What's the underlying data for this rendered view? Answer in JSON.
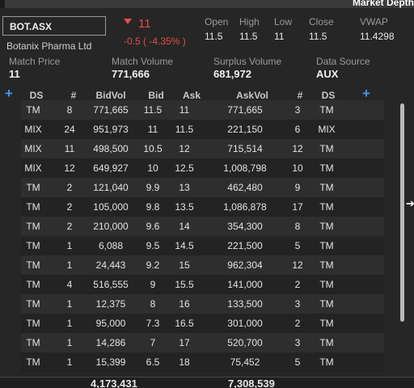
{
  "window": {
    "title": "Market Depth"
  },
  "security": {
    "code": "BOT.ASX",
    "name": "Botanix Pharma Ltd",
    "last": "11",
    "change_detail": "-0.5 ( -4.35% )",
    "direction": "down"
  },
  "stats": {
    "open_label": "Open",
    "open": "11.5",
    "high_label": "High",
    "high": "11.5",
    "low_label": "Low",
    "low": "11",
    "close_label": "Close",
    "close": "11.5",
    "vwap_label": "VWAP",
    "vwap": "11.4298"
  },
  "info": {
    "match_price_label": "Match Price",
    "match_price": "11",
    "match_volume_label": "Match Volume",
    "match_volume": "771,666",
    "surplus_volume_label": "Surplus Volume",
    "surplus_volume": "681,972",
    "data_source_label": "Data Source",
    "data_source": "AUX"
  },
  "table": {
    "headers": {
      "bid_ds": "DS",
      "bid_count": "#",
      "bid_vol": "BidVol",
      "bid": "Bid",
      "ask": "Ask",
      "ask_vol": "AskVol",
      "ask_count": "#",
      "ask_ds": "DS"
    },
    "rows": [
      {
        "bid_ds": "TM",
        "bid_count": "8",
        "bid_vol": "771,665",
        "bid": "11.5",
        "ask": "11",
        "ask_vol": "771,665",
        "ask_count": "3",
        "ask_ds": "TM"
      },
      {
        "bid_ds": "MIX",
        "bid_count": "24",
        "bid_vol": "951,973",
        "bid": "11",
        "ask": "11.5",
        "ask_vol": "221,150",
        "ask_count": "6",
        "ask_ds": "MIX"
      },
      {
        "bid_ds": "MIX",
        "bid_count": "11",
        "bid_vol": "498,500",
        "bid": "10.5",
        "ask": "12",
        "ask_vol": "715,514",
        "ask_count": "12",
        "ask_ds": "TM"
      },
      {
        "bid_ds": "MIX",
        "bid_count": "12",
        "bid_vol": "649,927",
        "bid": "10",
        "ask": "12.5",
        "ask_vol": "1,008,798",
        "ask_count": "10",
        "ask_ds": "TM"
      },
      {
        "bid_ds": "TM",
        "bid_count": "2",
        "bid_vol": "121,040",
        "bid": "9.9",
        "ask": "13",
        "ask_vol": "462,480",
        "ask_count": "9",
        "ask_ds": "TM"
      },
      {
        "bid_ds": "TM",
        "bid_count": "2",
        "bid_vol": "105,000",
        "bid": "9.8",
        "ask": "13.5",
        "ask_vol": "1,086,878",
        "ask_count": "17",
        "ask_ds": "TM"
      },
      {
        "bid_ds": "TM",
        "bid_count": "2",
        "bid_vol": "210,000",
        "bid": "9.6",
        "ask": "14",
        "ask_vol": "354,300",
        "ask_count": "8",
        "ask_ds": "TM"
      },
      {
        "bid_ds": "TM",
        "bid_count": "1",
        "bid_vol": "6,088",
        "bid": "9.5",
        "ask": "14.5",
        "ask_vol": "221,500",
        "ask_count": "5",
        "ask_ds": "TM"
      },
      {
        "bid_ds": "TM",
        "bid_count": "1",
        "bid_vol": "24,443",
        "bid": "9.2",
        "ask": "15",
        "ask_vol": "962,304",
        "ask_count": "12",
        "ask_ds": "TM"
      },
      {
        "bid_ds": "TM",
        "bid_count": "4",
        "bid_vol": "516,555",
        "bid": "9",
        "ask": "15.5",
        "ask_vol": "141,000",
        "ask_count": "2",
        "ask_ds": "TM"
      },
      {
        "bid_ds": "TM",
        "bid_count": "1",
        "bid_vol": "12,375",
        "bid": "8",
        "ask": "16",
        "ask_vol": "133,500",
        "ask_count": "3",
        "ask_ds": "TM"
      },
      {
        "bid_ds": "TM",
        "bid_count": "1",
        "bid_vol": "95,000",
        "bid": "7.3",
        "ask": "16.5",
        "ask_vol": "301,000",
        "ask_count": "2",
        "ask_ds": "TM"
      },
      {
        "bid_ds": "TM",
        "bid_count": "1",
        "bid_vol": "14,286",
        "bid": "7",
        "ask": "17",
        "ask_vol": "520,700",
        "ask_count": "3",
        "ask_ds": "TM"
      },
      {
        "bid_ds": "TM",
        "bid_count": "1",
        "bid_vol": "15,399",
        "bid": "6.5",
        "ask": "18",
        "ask_vol": "75,452",
        "ask_count": "5",
        "ask_ds": "TM"
      }
    ],
    "totals": {
      "bid_vol": "4,173,431",
      "ask_vol": "7,308,539"
    }
  },
  "icons": {
    "add_bid_column": "plus-icon",
    "add_ask_column": "plus-icon",
    "expand_panel": "arrow-right-icon",
    "change_direction": "triangle-down-icon"
  },
  "colors": {
    "background": "#262626",
    "negative": "#e84b4b",
    "accent": "#3d9be9",
    "row_alt": "#2e2e2e"
  }
}
